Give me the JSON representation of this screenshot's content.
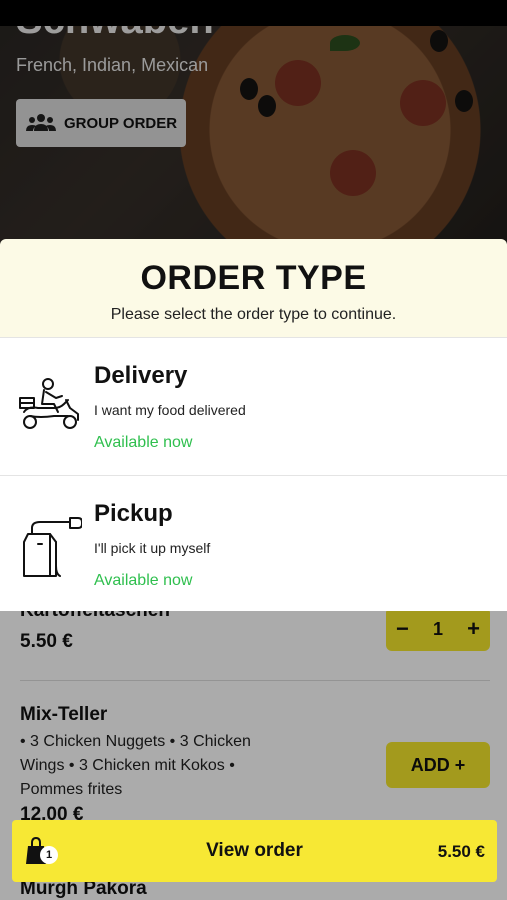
{
  "restaurant": {
    "name": "Schwaben",
    "cuisines": "French, Indian, Mexican",
    "group_order_label": "GROUP ORDER"
  },
  "modal": {
    "title": "ORDER TYPE",
    "subtitle": "Please select the order type to continue.",
    "options": [
      {
        "icon": "delivery-scooter-icon",
        "title": "Delivery",
        "description": "I want my food delivered",
        "status": "Available now"
      },
      {
        "icon": "pickup-bag-icon",
        "title": "Pickup",
        "description": "I'll pick it up myself",
        "status": "Available now"
      }
    ]
  },
  "menu": {
    "items": [
      {
        "name": "Kartoffeltaschen",
        "price": "5.50 €",
        "quantity": "1",
        "minus": "−",
        "plus": "+"
      },
      {
        "name": "Mix-Teller",
        "description": "• 3 Chicken Nuggets • 3 Chicken Wings • 3 Chicken mit Kokos • Pommes frites",
        "price": "12.00 €",
        "add_label": "ADD +"
      },
      {
        "name": "Murgh Pakora"
      }
    ]
  },
  "cart": {
    "label": "View order",
    "count": "1",
    "total": "5.50 €"
  },
  "colors": {
    "accent_yellow": "#f7e834",
    "available_green": "#2fbf4e",
    "modal_header_bg": "#fcfae6"
  }
}
